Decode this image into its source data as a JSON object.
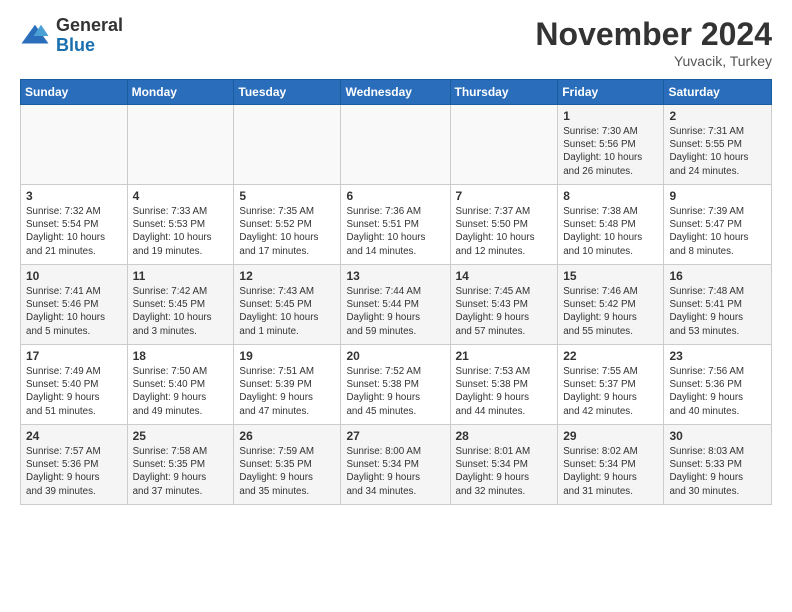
{
  "header": {
    "logo": {
      "general": "General",
      "blue": "Blue"
    },
    "title": "November 2024",
    "location": "Yuvacik, Turkey"
  },
  "weekdays": [
    "Sunday",
    "Monday",
    "Tuesday",
    "Wednesday",
    "Thursday",
    "Friday",
    "Saturday"
  ],
  "weeks": [
    [
      {
        "day": "",
        "info": ""
      },
      {
        "day": "",
        "info": ""
      },
      {
        "day": "",
        "info": ""
      },
      {
        "day": "",
        "info": ""
      },
      {
        "day": "",
        "info": ""
      },
      {
        "day": "1",
        "info": "Sunrise: 7:30 AM\nSunset: 5:56 PM\nDaylight: 10 hours\nand 26 minutes."
      },
      {
        "day": "2",
        "info": "Sunrise: 7:31 AM\nSunset: 5:55 PM\nDaylight: 10 hours\nand 24 minutes."
      }
    ],
    [
      {
        "day": "3",
        "info": "Sunrise: 7:32 AM\nSunset: 5:54 PM\nDaylight: 10 hours\nand 21 minutes."
      },
      {
        "day": "4",
        "info": "Sunrise: 7:33 AM\nSunset: 5:53 PM\nDaylight: 10 hours\nand 19 minutes."
      },
      {
        "day": "5",
        "info": "Sunrise: 7:35 AM\nSunset: 5:52 PM\nDaylight: 10 hours\nand 17 minutes."
      },
      {
        "day": "6",
        "info": "Sunrise: 7:36 AM\nSunset: 5:51 PM\nDaylight: 10 hours\nand 14 minutes."
      },
      {
        "day": "7",
        "info": "Sunrise: 7:37 AM\nSunset: 5:50 PM\nDaylight: 10 hours\nand 12 minutes."
      },
      {
        "day": "8",
        "info": "Sunrise: 7:38 AM\nSunset: 5:48 PM\nDaylight: 10 hours\nand 10 minutes."
      },
      {
        "day": "9",
        "info": "Sunrise: 7:39 AM\nSunset: 5:47 PM\nDaylight: 10 hours\nand 8 minutes."
      }
    ],
    [
      {
        "day": "10",
        "info": "Sunrise: 7:41 AM\nSunset: 5:46 PM\nDaylight: 10 hours\nand 5 minutes."
      },
      {
        "day": "11",
        "info": "Sunrise: 7:42 AM\nSunset: 5:45 PM\nDaylight: 10 hours\nand 3 minutes."
      },
      {
        "day": "12",
        "info": "Sunrise: 7:43 AM\nSunset: 5:45 PM\nDaylight: 10 hours\nand 1 minute."
      },
      {
        "day": "13",
        "info": "Sunrise: 7:44 AM\nSunset: 5:44 PM\nDaylight: 9 hours\nand 59 minutes."
      },
      {
        "day": "14",
        "info": "Sunrise: 7:45 AM\nSunset: 5:43 PM\nDaylight: 9 hours\nand 57 minutes."
      },
      {
        "day": "15",
        "info": "Sunrise: 7:46 AM\nSunset: 5:42 PM\nDaylight: 9 hours\nand 55 minutes."
      },
      {
        "day": "16",
        "info": "Sunrise: 7:48 AM\nSunset: 5:41 PM\nDaylight: 9 hours\nand 53 minutes."
      }
    ],
    [
      {
        "day": "17",
        "info": "Sunrise: 7:49 AM\nSunset: 5:40 PM\nDaylight: 9 hours\nand 51 minutes."
      },
      {
        "day": "18",
        "info": "Sunrise: 7:50 AM\nSunset: 5:40 PM\nDaylight: 9 hours\nand 49 minutes."
      },
      {
        "day": "19",
        "info": "Sunrise: 7:51 AM\nSunset: 5:39 PM\nDaylight: 9 hours\nand 47 minutes."
      },
      {
        "day": "20",
        "info": "Sunrise: 7:52 AM\nSunset: 5:38 PM\nDaylight: 9 hours\nand 45 minutes."
      },
      {
        "day": "21",
        "info": "Sunrise: 7:53 AM\nSunset: 5:38 PM\nDaylight: 9 hours\nand 44 minutes."
      },
      {
        "day": "22",
        "info": "Sunrise: 7:55 AM\nSunset: 5:37 PM\nDaylight: 9 hours\nand 42 minutes."
      },
      {
        "day": "23",
        "info": "Sunrise: 7:56 AM\nSunset: 5:36 PM\nDaylight: 9 hours\nand 40 minutes."
      }
    ],
    [
      {
        "day": "24",
        "info": "Sunrise: 7:57 AM\nSunset: 5:36 PM\nDaylight: 9 hours\nand 39 minutes."
      },
      {
        "day": "25",
        "info": "Sunrise: 7:58 AM\nSunset: 5:35 PM\nDaylight: 9 hours\nand 37 minutes."
      },
      {
        "day": "26",
        "info": "Sunrise: 7:59 AM\nSunset: 5:35 PM\nDaylight: 9 hours\nand 35 minutes."
      },
      {
        "day": "27",
        "info": "Sunrise: 8:00 AM\nSunset: 5:34 PM\nDaylight: 9 hours\nand 34 minutes."
      },
      {
        "day": "28",
        "info": "Sunrise: 8:01 AM\nSunset: 5:34 PM\nDaylight: 9 hours\nand 32 minutes."
      },
      {
        "day": "29",
        "info": "Sunrise: 8:02 AM\nSunset: 5:34 PM\nDaylight: 9 hours\nand 31 minutes."
      },
      {
        "day": "30",
        "info": "Sunrise: 8:03 AM\nSunset: 5:33 PM\nDaylight: 9 hours\nand 30 minutes."
      }
    ]
  ]
}
